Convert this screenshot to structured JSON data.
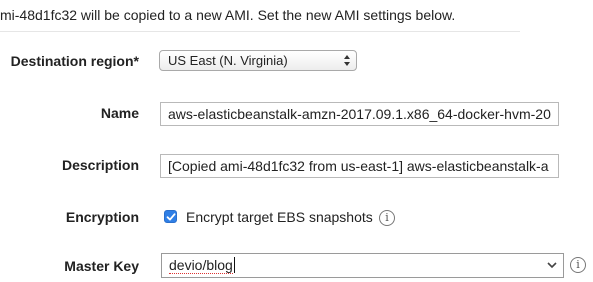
{
  "intro_text": "mi-48d1fc32 will be copied to a new AMI. Set the new AMI settings below.",
  "fields": {
    "destination_region": {
      "label": "Destination region*",
      "selected": "US East (N. Virginia)"
    },
    "name": {
      "label": "Name",
      "value": "aws-elasticbeanstalk-amzn-2017.09.1.x86_64-docker-hvm-20"
    },
    "description": {
      "label": "Description",
      "value": "[Copied ami-48d1fc32 from us-east-1] aws-elasticbeanstalk-a"
    },
    "encryption": {
      "label": "Encryption",
      "checkbox_label": "Encrypt target EBS snapshots",
      "checked": true
    },
    "master_key": {
      "label": "Master Key",
      "value": "devio/blog"
    }
  },
  "icons": {
    "info": "info-icon",
    "info_glyph": "i",
    "select_arrows": "updown-arrows-icon",
    "combo_chevron": "chevron-down-icon",
    "check": "checkmark-icon"
  },
  "colors": {
    "checkbox_accent": "#2f7fe6",
    "text": "#222222",
    "border": "#b9b9b9"
  }
}
